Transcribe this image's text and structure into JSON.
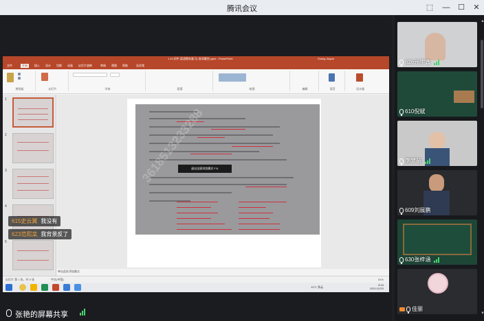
{
  "window": {
    "title": "腾讯会议",
    "controls": [
      "pin",
      "minimize",
      "maximize",
      "close"
    ]
  },
  "shared_screen": {
    "ppt": {
      "window_title": "1.10 初中 英语期末复习( 选词填空).pptx - PowerPoint",
      "user": "Zhang Jiayan",
      "menu_tabs": [
        "文件",
        "开始",
        "插入",
        "设计",
        "切换",
        "动画",
        "幻灯片放映",
        "审阅",
        "视图",
        "帮助",
        "告诉我"
      ],
      "active_tab": "开始",
      "ribbon_groups": [
        "剪贴板",
        "幻灯片",
        "字体",
        "段落",
        "绘图",
        "编辑",
        "语音",
        "设计器"
      ],
      "slide_numbers": [
        "1",
        "2",
        "3",
        "4",
        "5"
      ],
      "tooltip": "退出全屏浏览模式 F11",
      "watermark": "3618513233288",
      "notes_hint": "单击此处添加备注",
      "status_left": "幻灯片 第 1 张，共 5 张",
      "status_lang": "中文(中国)",
      "zoom": "81%"
    },
    "taskbar": {
      "temperature": "13°C 多云",
      "time": "8:34",
      "date": "2021/12/20"
    }
  },
  "chat_overlay": [
    {
      "name": "615史云翼",
      "message": "我没有"
    },
    {
      "name": "623范熙栾",
      "message": "我背景反了"
    }
  ],
  "participants": [
    {
      "name": "626元宇鑫",
      "signal": 3,
      "bg": "#cfd1d3"
    },
    {
      "name": "610倪斌",
      "signal": 0,
      "bg": "#1f4a3a"
    },
    {
      "name": "李梦茹",
      "signal": 3,
      "bg": "#c9c9c9"
    },
    {
      "name": "609刘展鹏",
      "signal": 0,
      "bg": "#2a2b2f"
    },
    {
      "name": "630张梓涵",
      "signal": 3,
      "bg": "#1d4637"
    },
    {
      "name": "佳丽",
      "signal": 0,
      "bg": "#2b2c30"
    }
  ],
  "bottom_bar": {
    "sharer_label": "张艳的屏幕共享",
    "signal": 3
  }
}
